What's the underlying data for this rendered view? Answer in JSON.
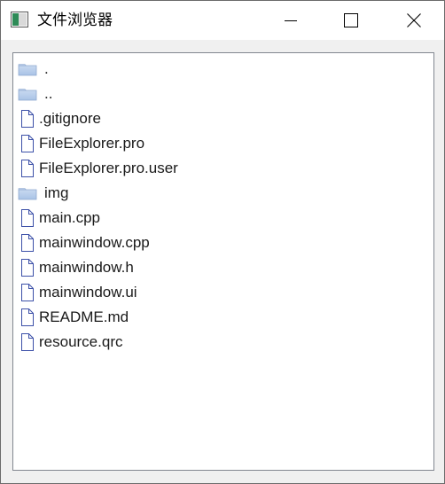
{
  "window": {
    "title": "文件浏览器",
    "icon": "app-window-icon",
    "controls": [
      "minimize-icon",
      "maximize-icon",
      "close-icon"
    ]
  },
  "file_list": {
    "items": [
      {
        "name": ".",
        "type": "folder",
        "icon": "folder-icon"
      },
      {
        "name": "..",
        "type": "folder",
        "icon": "folder-icon"
      },
      {
        "name": ".gitignore",
        "type": "file",
        "icon": "file-icon"
      },
      {
        "name": "FileExplorer.pro",
        "type": "file",
        "icon": "file-icon"
      },
      {
        "name": "FileExplorer.pro.user",
        "type": "file",
        "icon": "file-icon"
      },
      {
        "name": "img",
        "type": "folder",
        "icon": "folder-icon"
      },
      {
        "name": "main.cpp",
        "type": "file",
        "icon": "file-icon"
      },
      {
        "name": "mainwindow.cpp",
        "type": "file",
        "icon": "file-icon"
      },
      {
        "name": "mainwindow.h",
        "type": "file",
        "icon": "file-icon"
      },
      {
        "name": "mainwindow.ui",
        "type": "file",
        "icon": "file-icon"
      },
      {
        "name": "README.md",
        "type": "file",
        "icon": "file-icon"
      },
      {
        "name": "resource.qrc",
        "type": "file",
        "icon": "file-icon"
      }
    ]
  },
  "colors": {
    "file_icon_stroke": "#3c50a8",
    "folder_fill": "#a9c3e6"
  }
}
